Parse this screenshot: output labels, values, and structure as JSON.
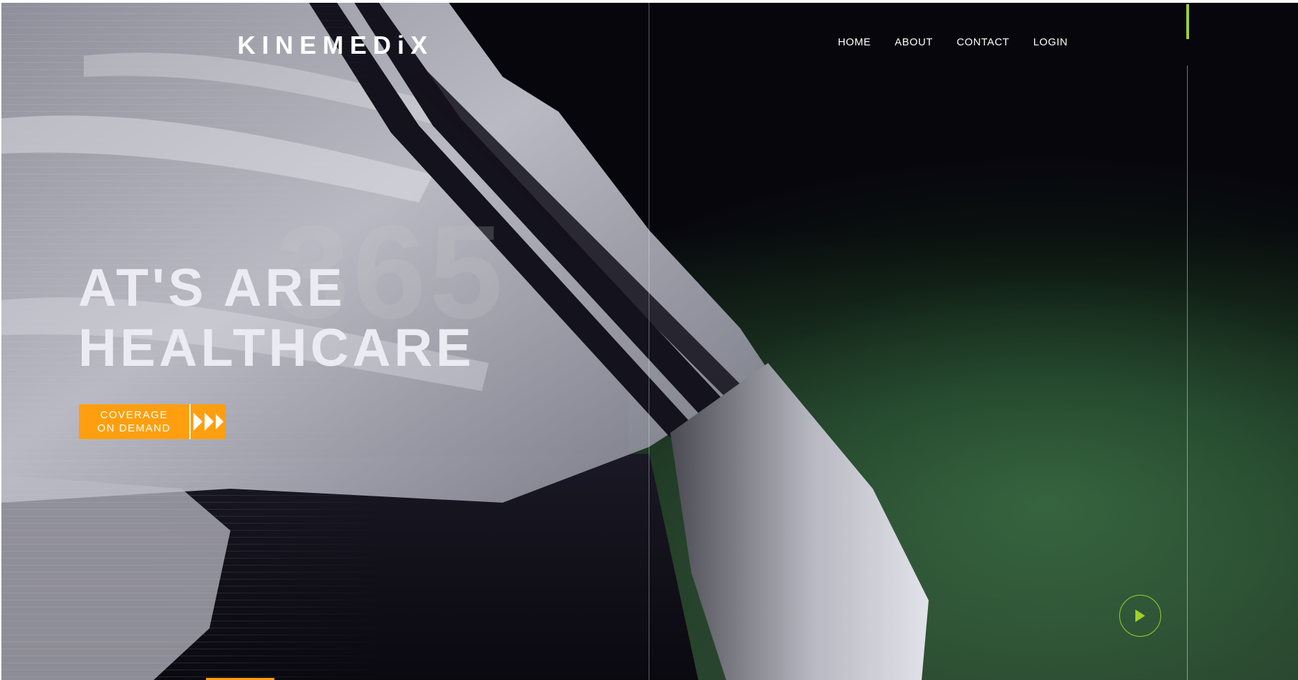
{
  "brand": {
    "logo_text": "KINEMEDiX"
  },
  "nav": {
    "items": [
      {
        "label": "HOME"
      },
      {
        "label": "ABOUT"
      },
      {
        "label": "CONTACT"
      },
      {
        "label": "LOGIN"
      }
    ]
  },
  "hero": {
    "background_number": "365",
    "title_line1": "AT'S ARE",
    "title_line2": "HEALTHCARE",
    "cta_line1": "COVERAGE",
    "cta_line2": "ON DEMAND"
  },
  "colors": {
    "accent_orange": "#ff9f0f",
    "accent_green": "#9fd12c",
    "background": "#07060d",
    "text": "#ffffff"
  },
  "icons": {
    "cta": "fast-forward-icon",
    "video": "play-icon"
  }
}
